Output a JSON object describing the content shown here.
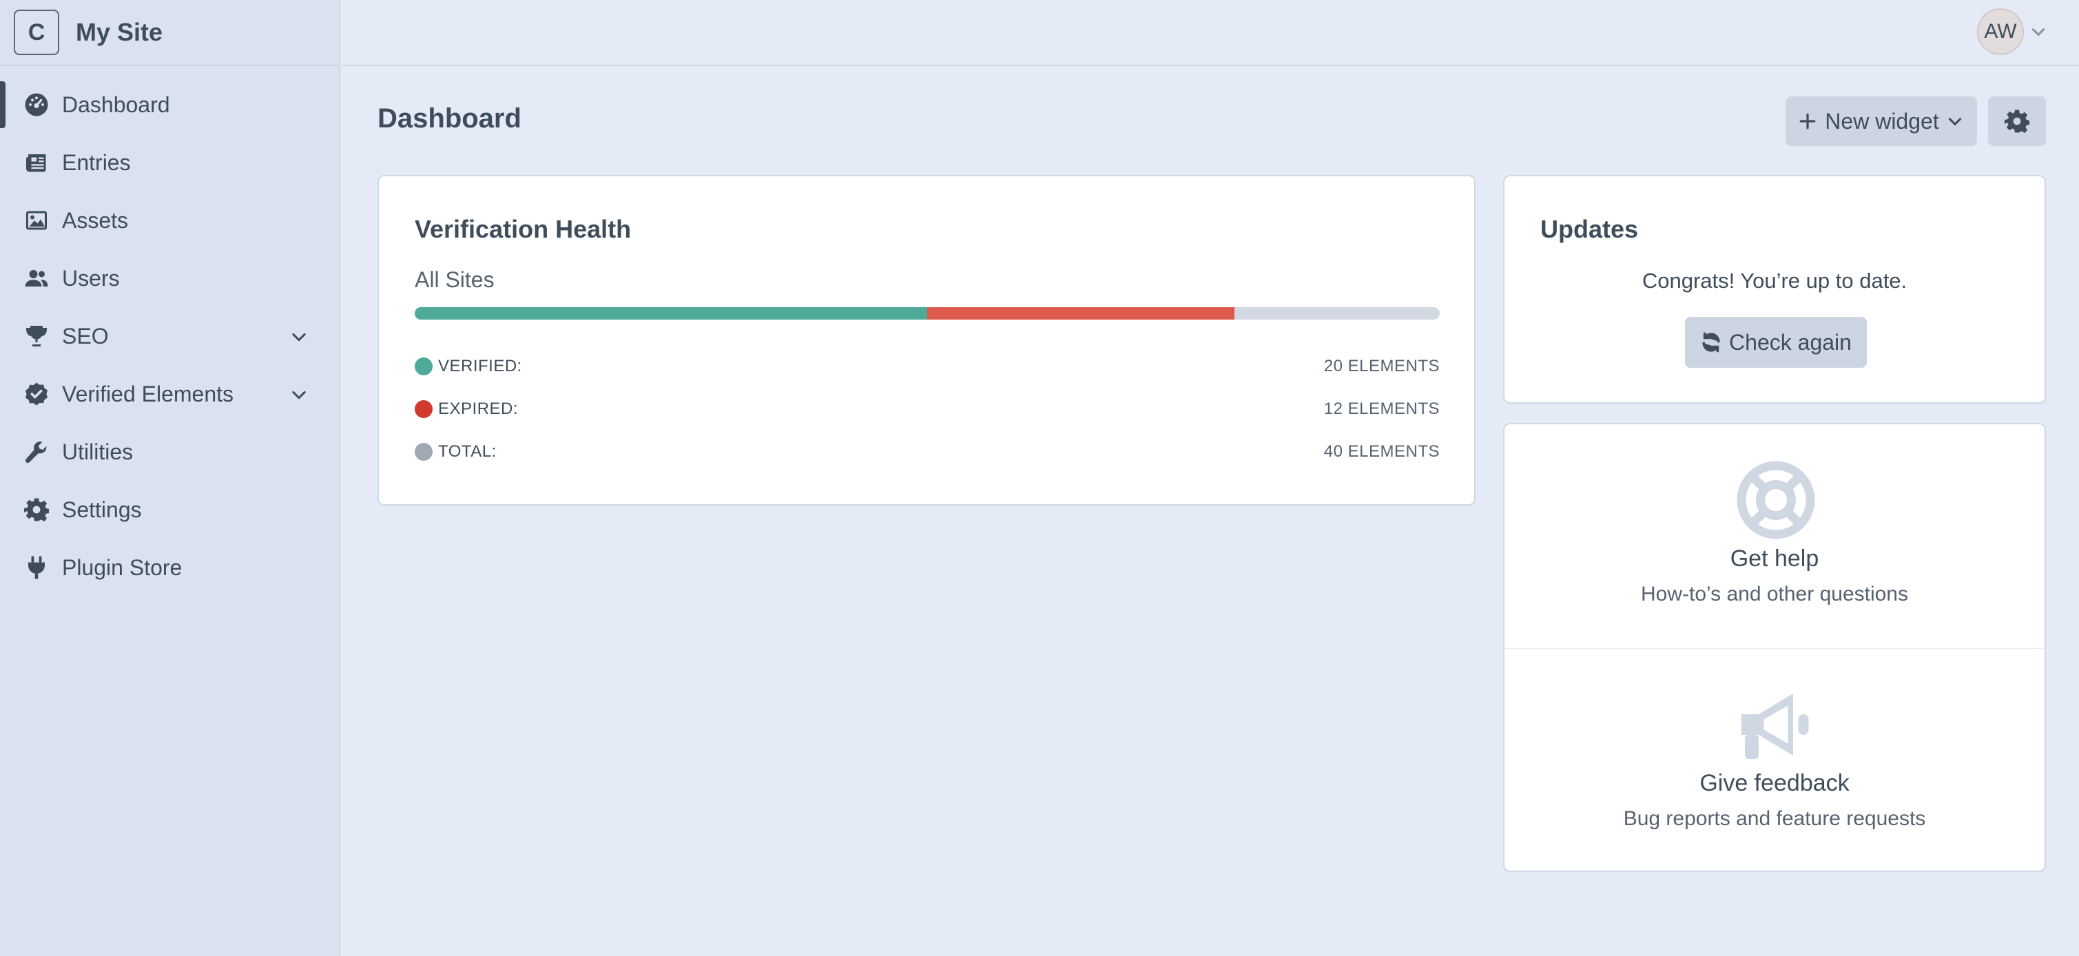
{
  "site": {
    "logo_letter": "C",
    "name": "My Site"
  },
  "sidebar": {
    "items": [
      {
        "label": "Dashboard",
        "icon": "dashboard-gauge-icon",
        "selected": true
      },
      {
        "label": "Entries",
        "icon": "newspaper-icon"
      },
      {
        "label": "Assets",
        "icon": "image-icon"
      },
      {
        "label": "Users",
        "icon": "users-icon"
      },
      {
        "label": "SEO",
        "icon": "trophy-icon",
        "expandable": true
      },
      {
        "label": "Verified Elements",
        "icon": "check-circle-icon",
        "expandable": true
      },
      {
        "label": "Utilities",
        "icon": "wrench-icon"
      },
      {
        "label": "Settings",
        "icon": "gear-icon"
      },
      {
        "label": "Plugin Store",
        "icon": "plug-icon"
      }
    ]
  },
  "user": {
    "initials": "AW"
  },
  "page": {
    "title": "Dashboard",
    "new_widget_label": "New widget"
  },
  "verification": {
    "title": "Verification Health",
    "subtitle": "All Sites",
    "verified_fraction": 0.5,
    "expired_fraction": 0.3,
    "rows": [
      {
        "label": "VERIFIED:",
        "value": "20 ELEMENTS",
        "color": "#4eab99"
      },
      {
        "label": "EXPIRED:",
        "value": "12 ELEMENTS",
        "color": "#d2392e"
      },
      {
        "label": "TOTAL:",
        "value": "40 ELEMENTS",
        "color": "#a0a8b4"
      }
    ]
  },
  "updates": {
    "title": "Updates",
    "message": "Congrats! You’re up to date.",
    "check_label": "Check again"
  },
  "help": {
    "get_help_title": "Get help",
    "get_help_desc": "How-to’s and other questions",
    "feedback_title": "Give feedback",
    "feedback_desc": "Bug reports and feature requests"
  },
  "colors": {
    "accent_verified": "#4eab99",
    "accent_expired": "#dc5a4b",
    "bar_track": "#d3d9e3",
    "icon_muted": "#cfd7e2"
  }
}
